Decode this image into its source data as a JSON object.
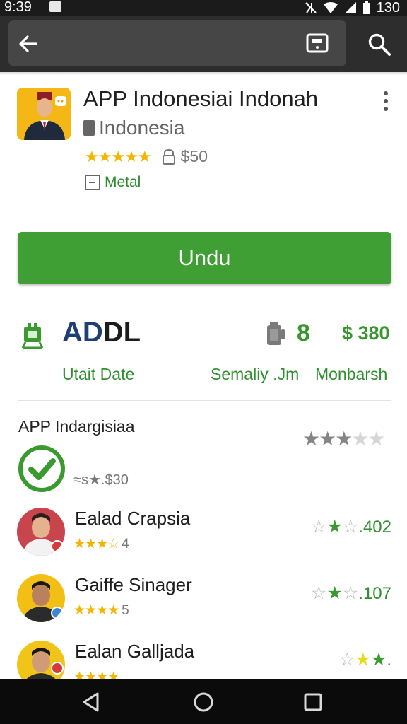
{
  "status_bar": {
    "time": "9:39",
    "battery_text": "130"
  },
  "toolbar": {
    "back": "back-arrow-icon",
    "cast": "cast-icon",
    "search": "search-icon"
  },
  "app": {
    "title": "APP Indonesiai Indonah",
    "developer": "Indonesia",
    "rating_stars": "★★★★★",
    "price": "$50",
    "category": "Metal",
    "install_label": "Undu"
  },
  "stats": {
    "big_value_prefix": "AD",
    "big_value_suffix": "DL",
    "number": "8",
    "price": "$ 380",
    "label_left": "Utait Date",
    "label_mid": "Semaliy .Jm",
    "label_right": "Monbarsh"
  },
  "review_summary": {
    "title": "APP Indargisiaa",
    "stars_on": "★★★",
    "stars_off": "★★",
    "count": "≈s★.$30"
  },
  "reviews": [
    {
      "name": "Ealad Crapsia",
      "stars": "★★★☆",
      "stars_count": "4",
      "meta_stars": [
        "☆",
        "★",
        "☆"
      ],
      "count": ".402"
    },
    {
      "name": "Gaiffe Sinager",
      "stars": "★★★★",
      "stars_count": "5",
      "meta_stars": [
        "☆",
        "★",
        "☆"
      ],
      "count": ".107"
    },
    {
      "name": "Ealan Galljada",
      "stars": "★★★★",
      "stars_count": "",
      "meta_stars": [
        "☆",
        "★",
        "★"
      ],
      "count": "."
    }
  ],
  "colors": {
    "accent_green": "#3f9f35",
    "status_bar": "#1b1b1b",
    "toolbar": "#2d2d2d",
    "star_yellow": "#f2b600",
    "title_blue": "#1d3f73"
  }
}
